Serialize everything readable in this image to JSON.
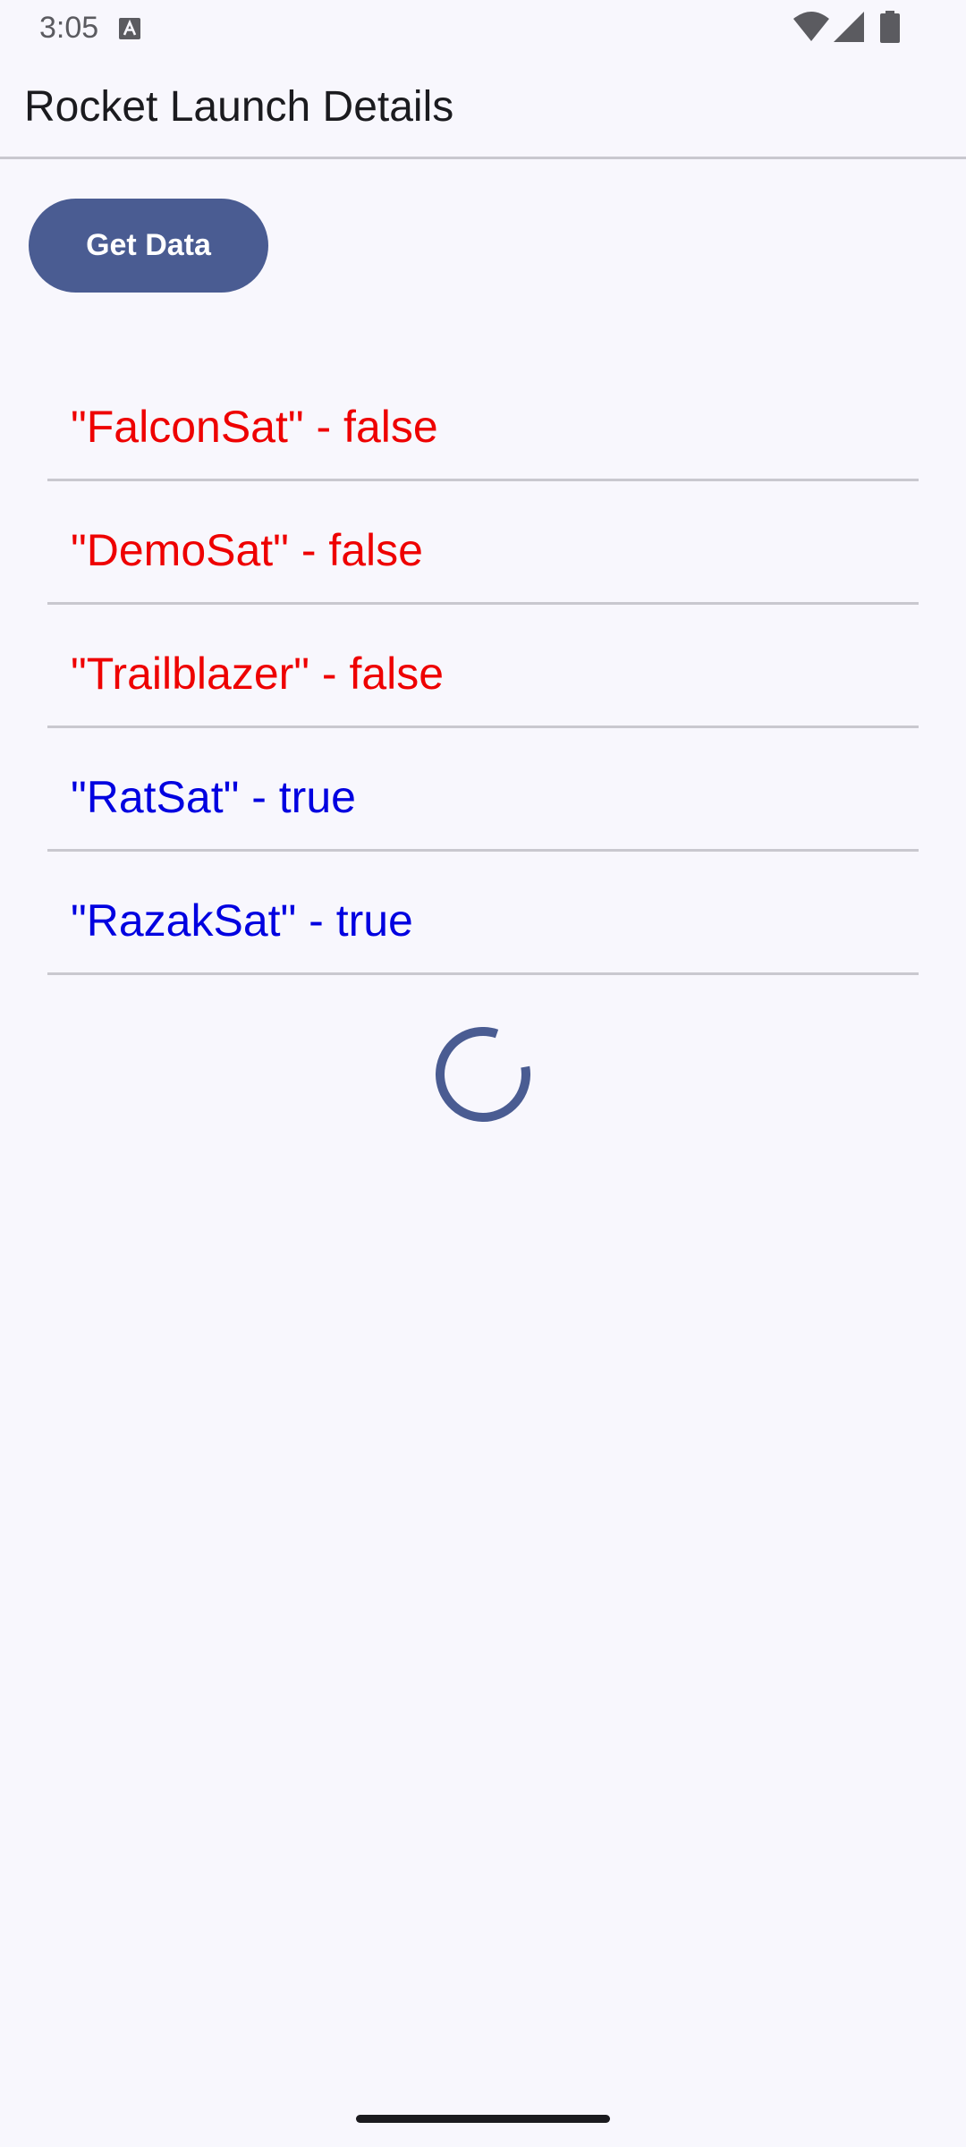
{
  "status_bar": {
    "time": "3:05",
    "notification_icon": "text-a-icon",
    "icons": [
      "wifi-icon",
      "cell-signal-icon",
      "battery-icon"
    ]
  },
  "app_bar": {
    "title": "Rocket Launch Details"
  },
  "actions": {
    "get_data_label": "Get Data"
  },
  "launches": [
    {
      "label": "\"FalconSat\" - false",
      "success": false
    },
    {
      "label": "\"DemoSat\" - false",
      "success": false
    },
    {
      "label": "\"Trailblazer\" - false",
      "success": false
    },
    {
      "label": "\"RatSat\" - true",
      "success": true
    },
    {
      "label": "\"RazakSat\" - true",
      "success": true
    }
  ],
  "colors": {
    "success_true": "#0000e0",
    "success_false": "#ee0000",
    "accent": "#4a5c92",
    "background": "#f8f7fd"
  },
  "loading": {
    "indicator": "progress-spinner"
  }
}
